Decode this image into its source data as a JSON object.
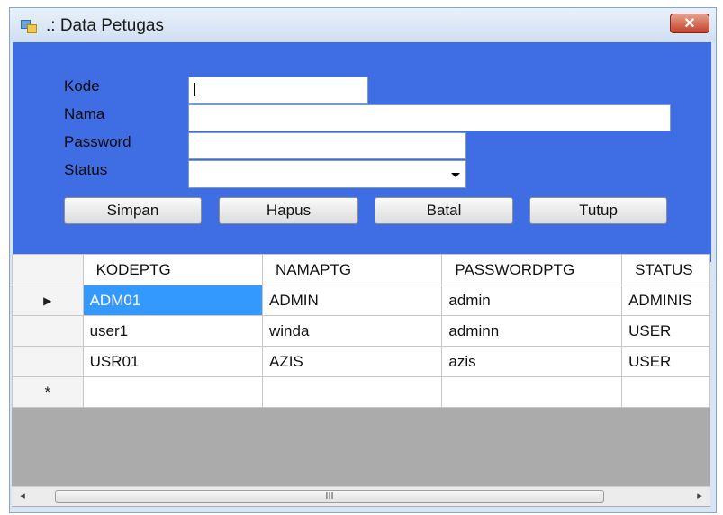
{
  "window": {
    "title": ".: Data Petugas",
    "close_icon": "close-icon",
    "app_icon": "window-app-icon"
  },
  "form": {
    "kode_label": "Kode",
    "nama_label": "Nama",
    "password_label": "Password",
    "status_label": "Status",
    "kode_value": "",
    "nama_value": "",
    "password_value": "",
    "status_value": ""
  },
  "buttons": {
    "simpan": "Simpan",
    "hapus": "Hapus",
    "batal": "Batal",
    "tutup": "Tutup"
  },
  "grid": {
    "columns": [
      "KODEPTG",
      "NAMAPTG",
      "PASSWORDPTG",
      "STATUS"
    ],
    "rows": [
      {
        "indicator": "▶",
        "cells": [
          "ADM01",
          "ADMIN",
          "admin",
          "ADMINIS"
        ]
      },
      {
        "indicator": "",
        "cells": [
          "user1",
          "winda",
          "adminn",
          "USER"
        ]
      },
      {
        "indicator": "",
        "cells": [
          "USR01",
          "AZIS",
          "azis",
          "USER"
        ]
      }
    ],
    "new_row_indicator": "*"
  },
  "scrollbar": {
    "left_arrow": "◂",
    "right_arrow": "▸",
    "thumb_grip": "III"
  },
  "colors": {
    "panel": "#3f6de4",
    "selection": "#3399ff",
    "grid_background": "#ababab"
  }
}
